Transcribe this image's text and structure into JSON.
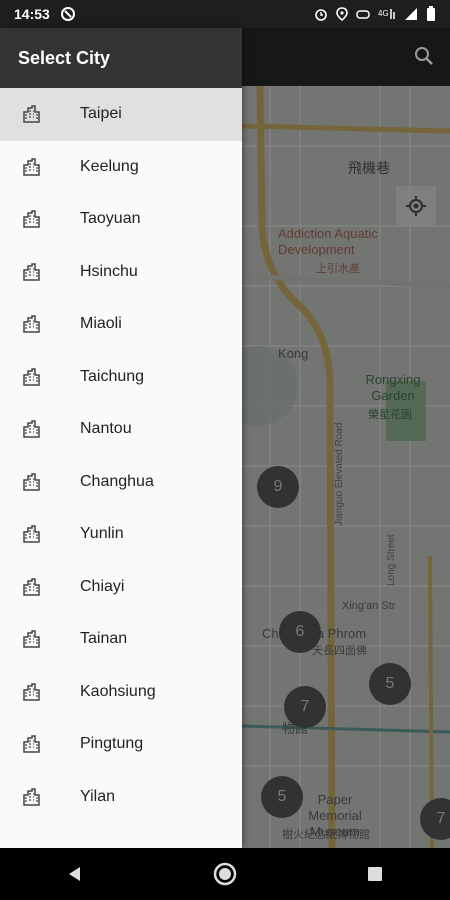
{
  "status_bar": {
    "time": "14:53"
  },
  "drawer": {
    "title": "Select City",
    "cities": [
      {
        "label": "Taipei"
      },
      {
        "label": "Keelung"
      },
      {
        "label": "Taoyuan"
      },
      {
        "label": "Hsinchu"
      },
      {
        "label": "Miaoli"
      },
      {
        "label": "Taichung"
      },
      {
        "label": "Nantou"
      },
      {
        "label": "Changhua"
      },
      {
        "label": "Yunlin"
      },
      {
        "label": "Chiayi"
      },
      {
        "label": "Tainan"
      },
      {
        "label": "Kaohsiung"
      },
      {
        "label": "Pingtung"
      },
      {
        "label": "Yilan"
      }
    ]
  },
  "map": {
    "labels": {
      "aquatic": "Addiction Aquatic Development",
      "aquatic_zh": "上引水產",
      "kong": "Kong",
      "rongxing": "Rongxing Garden",
      "rongxing_zh": "榮星花園",
      "feijixiang": "飛機巷",
      "jianguo": "Jianguo Elevated Road",
      "long_street": "Long Street",
      "xingan": "Xing'an Str",
      "chan_phra": "Chan Phra Phrom",
      "chan_phra_zh": "天長四面佛",
      "paper_museum": "Paper Memorial Museum",
      "paper_museum_zh": "樹火紀念紙博物館",
      "museum_zh": "物館"
    },
    "clusters": [
      "9",
      "6",
      "5",
      "7",
      "5",
      "7"
    ]
  }
}
